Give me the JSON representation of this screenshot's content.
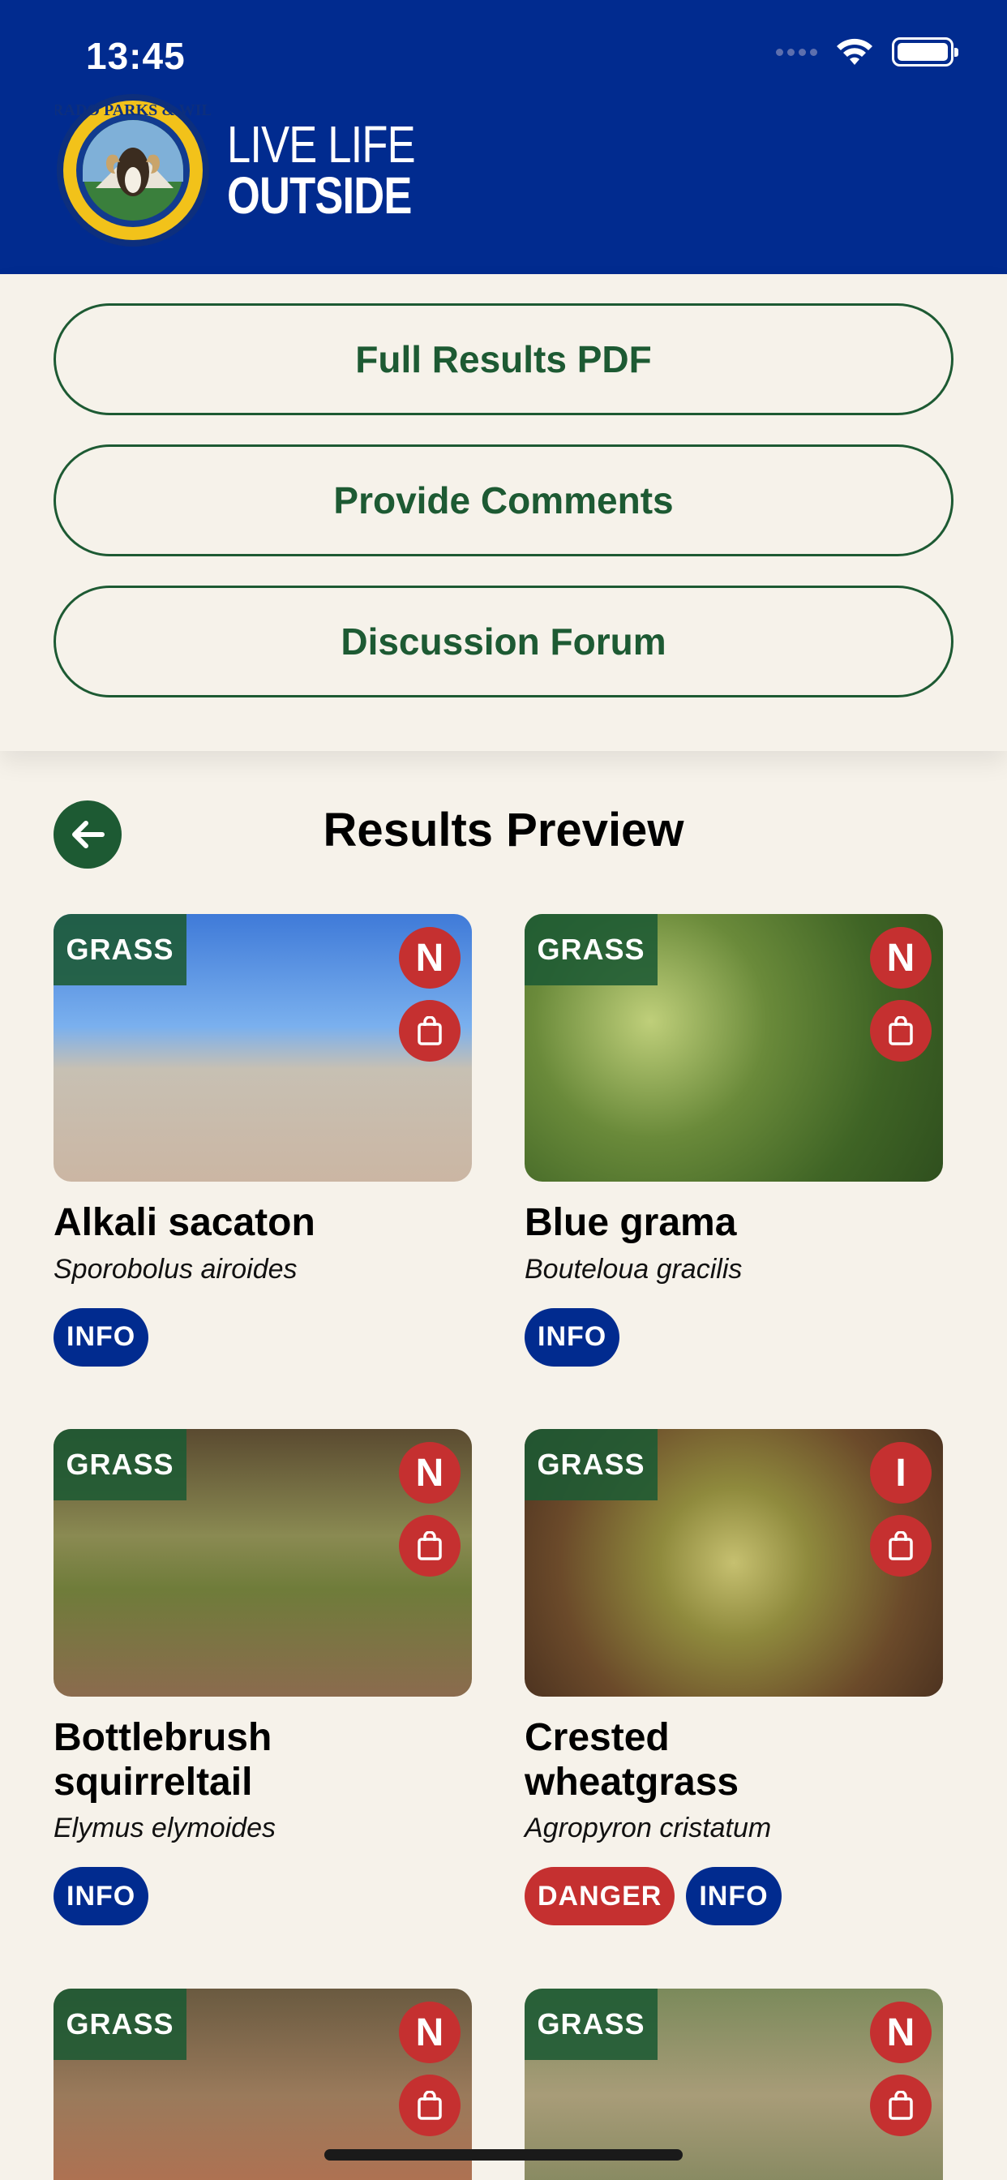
{
  "status_bar": {
    "time": "13:45"
  },
  "header": {
    "logo_ring_text": "COLORADO PARKS & WILDLIFE",
    "logo_line1": "LIVE LIFE",
    "logo_line2": "OUTSIDE"
  },
  "actions": {
    "full_results": "Full Results PDF",
    "comments": "Provide Comments",
    "forum": "Discussion Forum"
  },
  "results": {
    "title": "Results Preview",
    "cards": [
      {
        "category": "GRASS",
        "status": "N",
        "name": "Alkali sacaton",
        "scientific": "Sporobolus airoides",
        "chips": [
          "INFO"
        ]
      },
      {
        "category": "GRASS",
        "status": "N",
        "name": "Blue grama",
        "scientific": "Bouteloua gracilis",
        "chips": [
          "INFO"
        ]
      },
      {
        "category": "GRASS",
        "status": "N",
        "name": "Bottlebrush squirreltail",
        "scientific": "Elymus elymoides",
        "chips": [
          "INFO"
        ]
      },
      {
        "category": "GRASS",
        "status": "I",
        "name": "Crested wheatgrass",
        "scientific": "Agropyron cristatum",
        "chips": [
          "DANGER",
          "INFO"
        ]
      },
      {
        "category": "GRASS",
        "status": "N"
      },
      {
        "category": "GRASS",
        "status": "N"
      }
    ]
  },
  "colors": {
    "header_blue": "#012b8f",
    "accent_green": "#1d5a33",
    "danger_red": "#c53030",
    "background": "#f6f2ea"
  },
  "icons": {
    "back": "arrow-left-icon",
    "bag": "shopping-bag-icon",
    "wifi": "wifi-icon",
    "battery": "battery-icon"
  }
}
